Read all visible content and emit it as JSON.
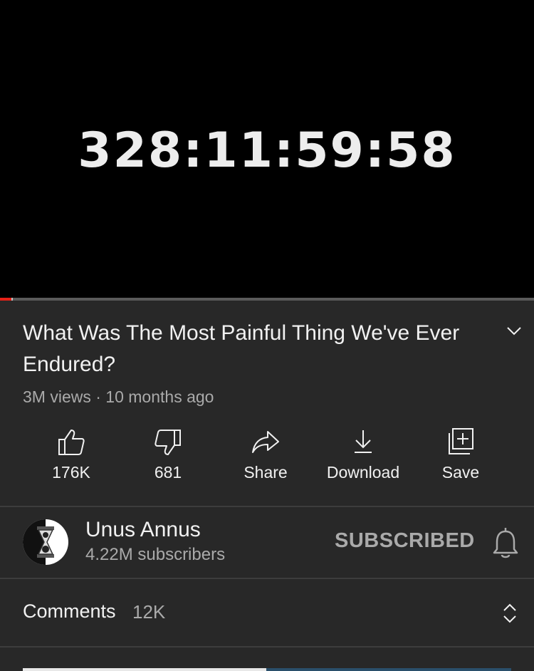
{
  "player": {
    "timer_text": "328:11:59:58",
    "progress_fraction": 0.021,
    "buffer_fraction": 0.024
  },
  "video": {
    "title": "What Was The Most Painful Thing We've Ever Endured?",
    "meta": "3M views · 10 months ago"
  },
  "actions": {
    "like_count": "176K",
    "dislike_count": "681",
    "share_label": "Share",
    "download_label": "Download",
    "save_label": "Save"
  },
  "channel": {
    "name": "Unus Annus",
    "subscribers": "4.22M subscribers",
    "subscribe_state": "SUBSCRIBED"
  },
  "comments": {
    "label": "Comments",
    "count": "12K"
  },
  "colors": {
    "background": "#282828",
    "progress_red": "#e62117",
    "secondary_text": "#aaaaaa",
    "primary_text": "#f1f1f1"
  }
}
